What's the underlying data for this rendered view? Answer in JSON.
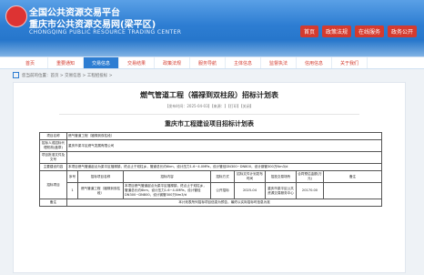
{
  "header": {
    "line1": "全国公共资源交易平台",
    "line2": "重庆市公共资源交易网(梁平区)",
    "line3": "CHONGQING PUBLIC RESOURCE TRADING CENTER",
    "links": [
      "首页",
      "政策法规",
      "在线服务",
      "政务公开"
    ]
  },
  "nav": [
    "首页",
    "重要通知",
    "交易信息",
    "交易结果",
    "政策法规",
    "服务导航",
    "主体信息",
    "监督执法",
    "信用信息",
    "关于我们"
  ],
  "breadcrumb": {
    "text": "您当前的位置：首页 > 交易信息 > 工程招投标 >"
  },
  "article": {
    "title": "燃气管道工程（福禄到双柱段）招标计划表",
    "meta": "【发布时间：2025-04-03】【来源：】【打印】【关闭】",
    "table_title": "重庆市工程建设项目招标计划表"
  },
  "table": {
    "project_name_label": "项目名称",
    "project_name": "燃气管道工程（福禄到双柱段）",
    "tenderer_label": "招标人或招标代理机构(盖章)",
    "tenderer": "重庆市梁平区燃气发展有限公司",
    "approval_label": "项目批准文件及文号",
    "approval": "",
    "scope_label": "主要建设内容",
    "scope": "本项目燃气管道起点为梁平区福禄镇，终点止于双柱乡，管道总长约6km，设计压力1.6~4.0MPa，设计管径DN300~DN800，设计钢管300万Nm3/d",
    "plan_label": "招标项目",
    "col_headers": [
      "序号",
      "招标项目名称",
      "招标内容",
      "招标方式",
      "招标文件计划发布时间",
      "招投交易场所",
      "合同预估金额(万元)",
      "备注"
    ],
    "rows": [
      {
        "no": "1",
        "name": "燃气管道工程（福禄到双柱段）",
        "content": "本项目燃气管道起点为梁平区福禄镇，终点止于双柱乡，管道总长约6km，设计压力1.6~4.0MPa，设计管径DN300~DN800，设计钢管300万Nm3/d",
        "method": "公开招标",
        "time": "2025-04",
        "venue": "重庆市梁平区公共资源交易服务中心",
        "amount": "20170.00",
        "remark": ""
      }
    ],
    "note_label": "备注",
    "note": "本计划表所列招标项目信息为预告，最终以实际招标时信息为准"
  }
}
